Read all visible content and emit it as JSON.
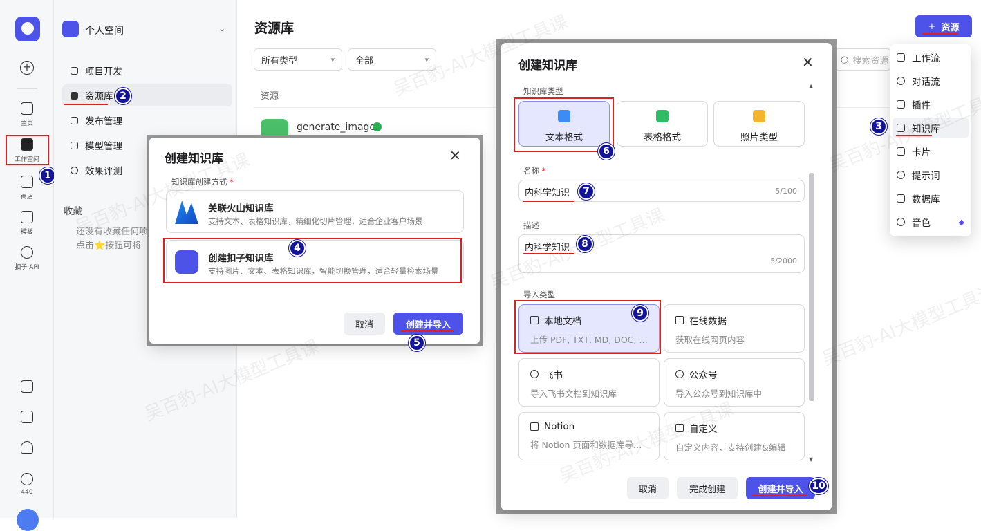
{
  "rail": {
    "items": [
      {
        "label": "主页"
      },
      {
        "label": "工作空间"
      },
      {
        "label": "商店"
      },
      {
        "label": "模板"
      },
      {
        "label": "扣子 API"
      }
    ],
    "points": "440"
  },
  "panel": {
    "space_name": "个人空间",
    "nav": [
      "项目开发",
      "资源库",
      "发布管理",
      "模型管理",
      "效果评测"
    ],
    "fav_title": "收藏",
    "fav_empty_1": "还没有收藏任何项",
    "fav_empty_2": "点击⭐按钮可将"
  },
  "main": {
    "title": "资源库",
    "filter_type": "所有类型",
    "filter_all": "全部",
    "col_resource": "资源",
    "row_name": "generate_image",
    "search_placeholder": "搜索资源",
    "add_button": "资源"
  },
  "add_menu": [
    "工作流",
    "对话流",
    "插件",
    "知识库",
    "卡片",
    "提示词",
    "数据库",
    "音色"
  ],
  "dialog1": {
    "title": "创建知识库",
    "method_label": "知识库创建方式",
    "opt1_title": "关联火山知识库",
    "opt1_desc": "支持文本、表格知识库，精细化切片管理，适合企业客户场景",
    "opt2_title": "创建扣子知识库",
    "opt2_desc": "支持图片、文本、表格知识库，智能切换管理，适合轻量检索场景",
    "cancel": "取消",
    "submit": "创建并导入"
  },
  "dialog2": {
    "title": "创建知识库",
    "type_label": "知识库类型",
    "types": [
      "文本格式",
      "表格格式",
      "照片类型"
    ],
    "name_label": "名称",
    "name_value": "内科学知识",
    "name_count": "5/100",
    "desc_label": "描述",
    "desc_value": "内科学知识",
    "desc_count": "5/2000",
    "import_label": "导入类型",
    "imports": [
      {
        "title": "本地文档",
        "desc": "上传 PDF, TXT, MD, DOC, …"
      },
      {
        "title": "在线数据",
        "desc": "获取在线网页内容"
      },
      {
        "title": "飞书",
        "desc": "导入飞书文档到知识库"
      },
      {
        "title": "公众号",
        "desc": "导入公众号到知识库中"
      },
      {
        "title": "Notion",
        "desc": "将 Notion 页面和数据库导…"
      },
      {
        "title": "自定义",
        "desc": "自定义内容，支持创建&编辑"
      }
    ],
    "cancel": "取消",
    "done": "完成创建",
    "submit": "创建并导入"
  },
  "steps": [
    "1",
    "2",
    "3",
    "4",
    "5",
    "6",
    "7",
    "8",
    "9",
    "10"
  ],
  "watermark": "吴百豹-AI大模型工具课",
  "colors": {
    "brand": "#4d53e8",
    "highlight": "#e02020",
    "step": "#12149a"
  }
}
